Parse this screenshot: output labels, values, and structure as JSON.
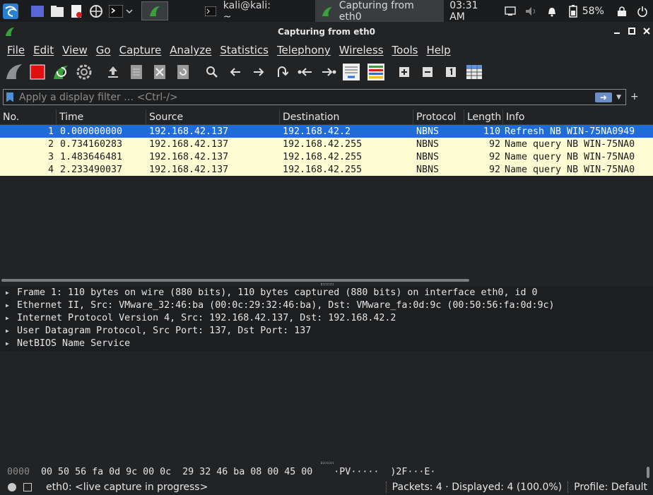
{
  "taskbar": {
    "buttons": [
      {
        "label": "kali@kali: ~"
      },
      {
        "label": "Capturing from eth0"
      }
    ],
    "clock": "03:31 AM",
    "battery": "58%"
  },
  "window": {
    "title": "Capturing from eth0"
  },
  "menu": {
    "items": [
      "File",
      "Edit",
      "View",
      "Go",
      "Capture",
      "Analyze",
      "Statistics",
      "Telephony",
      "Wireless",
      "Tools",
      "Help"
    ]
  },
  "filter": {
    "placeholder": "Apply a display filter … <Ctrl-/>",
    "apply_icon": "arrow-right-icon",
    "add_label": "+"
  },
  "packet_list": {
    "columns": [
      "No.",
      "Time",
      "Source",
      "Destination",
      "Protocol",
      "Length",
      "Info"
    ],
    "rows": [
      {
        "no": "1",
        "time": "0.000000000",
        "source": "192.168.42.137",
        "destination": "192.168.42.2",
        "protocol": "NBNS",
        "length": "110",
        "info": "Refresh NB WIN-75NA0949"
      },
      {
        "no": "2",
        "time": "0.734160283",
        "source": "192.168.42.137",
        "destination": "192.168.42.255",
        "protocol": "NBNS",
        "length": "92",
        "info": "Name query NB WIN-75NA0"
      },
      {
        "no": "3",
        "time": "1.483646481",
        "source": "192.168.42.137",
        "destination": "192.168.42.255",
        "protocol": "NBNS",
        "length": "92",
        "info": "Name query NB WIN-75NA0"
      },
      {
        "no": "4",
        "time": "2.233490037",
        "source": "192.168.42.137",
        "destination": "192.168.42.255",
        "protocol": "NBNS",
        "length": "92",
        "info": "Name query NB WIN-75NA0"
      }
    ],
    "selected_row": 1
  },
  "details": {
    "rows": [
      "Frame 1: 110 bytes on wire (880 bits), 110 bytes captured (880 bits) on interface eth0, id 0",
      "Ethernet II, Src: VMware_32:46:ba (00:0c:29:32:46:ba), Dst: VMware_fa:0d:9c (00:50:56:fa:0d:9c)",
      "Internet Protocol Version 4, Src: 192.168.42.137, Dst: 192.168.42.2",
      "User Datagram Protocol, Src Port: 137, Dst Port: 137",
      "NetBIOS Name Service"
    ]
  },
  "bytes": {
    "offset": "0000",
    "hex": "00 50 56 fa 0d 9c 00 0c  29 32 46 ba 08 00 45 00",
    "ascii": "·PV·····  )2F···E·"
  },
  "status": {
    "capture": "eth0: <live capture in progress>",
    "packets": "Packets: 4 · Displayed: 4 (100.0%)",
    "profile": "Profile: Default"
  },
  "colors": {
    "selected_row": "#1f6cd8",
    "nbns_row": "#fcfdd2",
    "background": "#222325",
    "stop_button": "#e01010",
    "shark_fin": "#3aa03a"
  },
  "toolbar_icons": [
    "shark-fin-start-icon",
    "stop-capture-icon",
    "restart-capture-icon",
    "capture-options-icon",
    "open-file-icon",
    "save-file-icon",
    "close-file-icon",
    "reload-file-icon",
    "find-packet-icon",
    "go-back-icon",
    "go-forward-icon",
    "go-to-packet-icon",
    "first-packet-icon",
    "last-packet-icon",
    "autoscroll-icon",
    "colorize-icon",
    "zoom-in-icon",
    "zoom-out-icon",
    "normal-size-icon",
    "resize-columns-icon"
  ]
}
